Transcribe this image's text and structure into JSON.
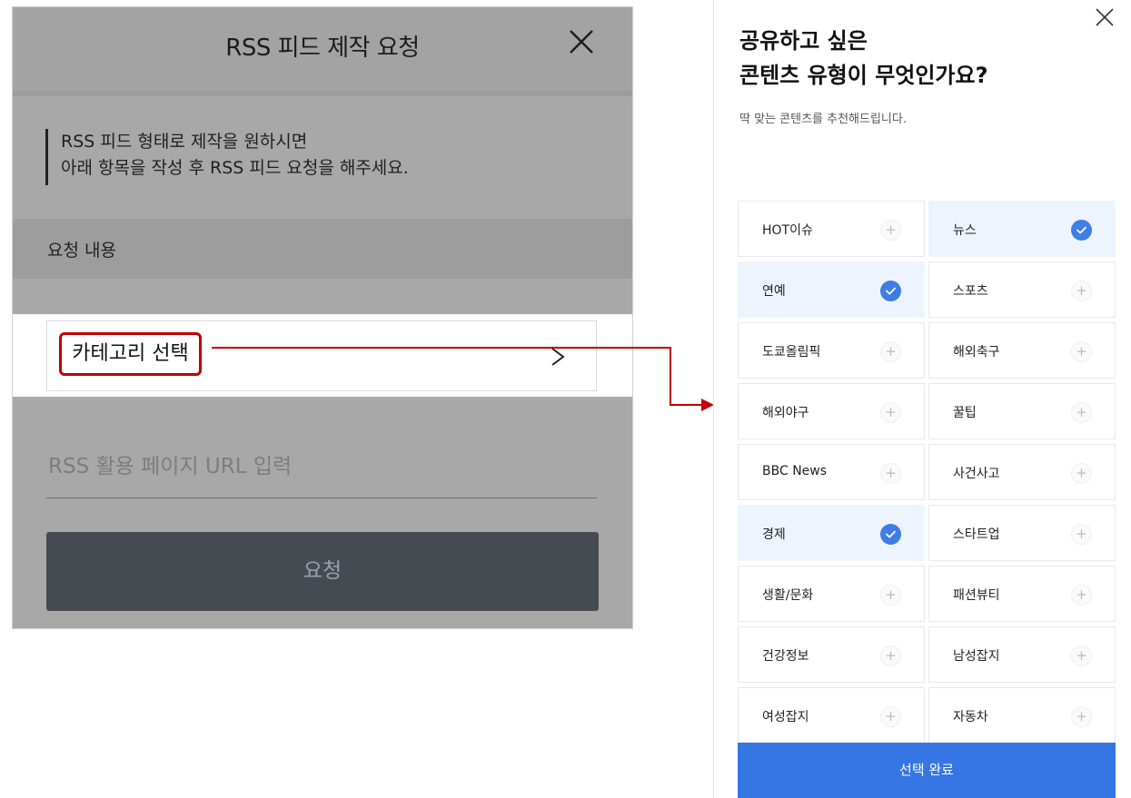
{
  "left_panel": {
    "title": "RSS 피드 제작 요청",
    "description_line1": "RSS 피드 형태로 제작을 원하시면",
    "description_line2": "아래 항목을 작성 후 RSS 피드 요청을 해주세요.",
    "section_label": "요청 내용",
    "category_select_label": "카테고리 선택",
    "url_placeholder": "RSS 활용 페이지 URL 입력",
    "request_button": "요청"
  },
  "right_panel": {
    "title_line1": "공유하고 싶은",
    "title_line2": "콘텐츠 유형이 무엇인가요?",
    "subtitle": "딱 맞는 콘텐츠를 추천해드립니다.",
    "categories": [
      {
        "label": "HOT이슈",
        "selected": false
      },
      {
        "label": "뉴스",
        "selected": true
      },
      {
        "label": "연예",
        "selected": true
      },
      {
        "label": "스포츠",
        "selected": false
      },
      {
        "label": "도쿄올림픽",
        "selected": false
      },
      {
        "label": "해외축구",
        "selected": false
      },
      {
        "label": "해외야구",
        "selected": false
      },
      {
        "label": "꿀팁",
        "selected": false
      },
      {
        "label": "BBC News",
        "selected": false
      },
      {
        "label": "사건사고",
        "selected": false
      },
      {
        "label": "경제",
        "selected": true
      },
      {
        "label": "스타트업",
        "selected": false
      },
      {
        "label": "생활/문화",
        "selected": false
      },
      {
        "label": "패션뷰티",
        "selected": false
      },
      {
        "label": "건강정보",
        "selected": false
      },
      {
        "label": "남성잡지",
        "selected": false
      },
      {
        "label": "여성잡지",
        "selected": false
      },
      {
        "label": "자동차",
        "selected": false
      }
    ],
    "complete_button": "선택 완료"
  },
  "colors": {
    "highlight_box": "#c00000",
    "connector_arrow": "#c00000",
    "accent_blue": "#3575e4",
    "selected_cell_bg": "#eef4fd",
    "request_button_bg": "#464b52"
  },
  "icons": {
    "close": "close-icon",
    "chevron": "chevron-right-icon",
    "plus": "plus-icon",
    "check": "check-circle-icon"
  }
}
